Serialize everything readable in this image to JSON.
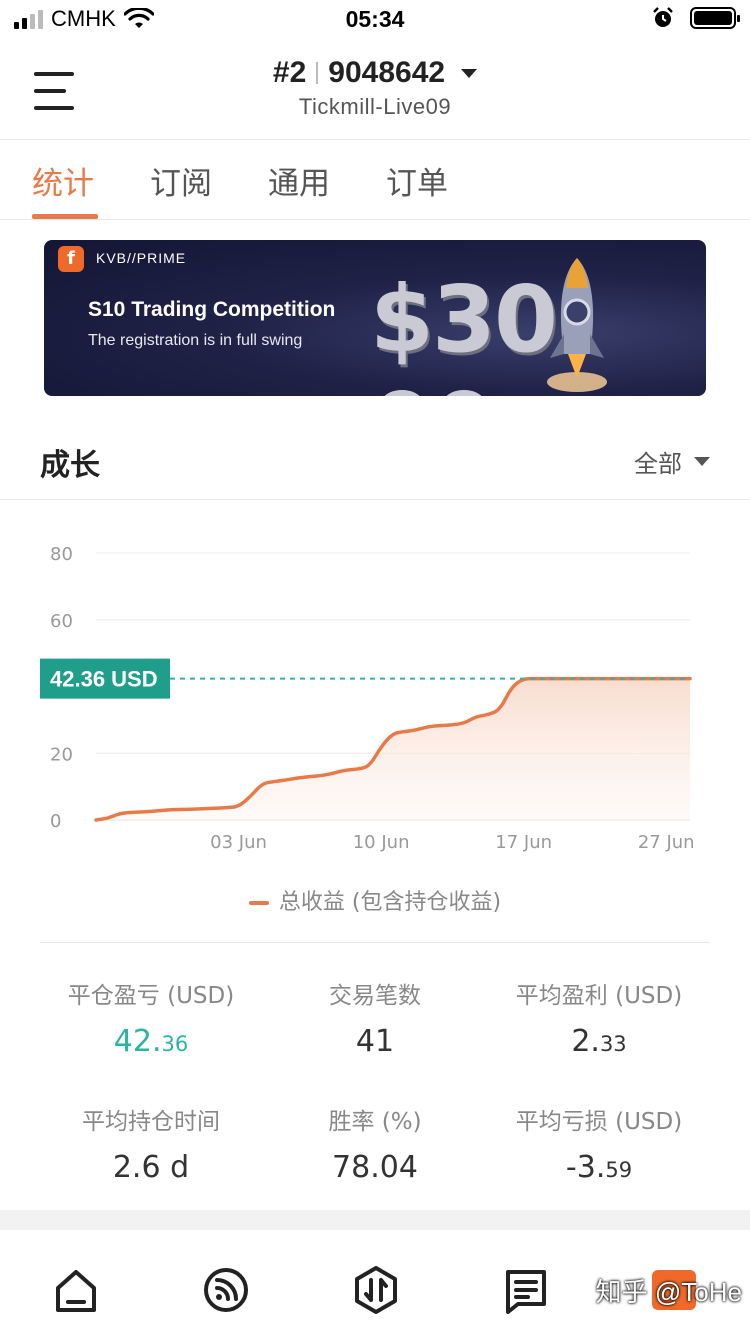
{
  "status": {
    "carrier": "CMHK",
    "time": "05:34"
  },
  "header": {
    "account_num": "#2",
    "account_id": "9048642",
    "server": "Tickmill-Live09"
  },
  "tabs": [
    {
      "label": "统计"
    },
    {
      "label": "订阅"
    },
    {
      "label": "通用"
    },
    {
      "label": "订单"
    }
  ],
  "banner": {
    "brand": "KVB//PRIME",
    "title": "S10 Trading Competition",
    "subtitle": "The registration is in full swing",
    "amount": "$30 00"
  },
  "growth": {
    "title": "成长",
    "filter": "全部"
  },
  "chart_data": {
    "type": "area",
    "y_ticks": [
      "80",
      "60",
      "20",
      "0"
    ],
    "x_ticks": [
      "03 Jun",
      "10 Jun",
      "17 Jun",
      "27 Jun"
    ],
    "current_label": "42.36 USD",
    "ylim": [
      0,
      80
    ],
    "series": [
      {
        "name": "总收益 (包含持仓收益)",
        "x": [
          0,
          1,
          2,
          3,
          4,
          5,
          6,
          7,
          8,
          9,
          10,
          11,
          12,
          13,
          14,
          15,
          16,
          17,
          18,
          19,
          20,
          21,
          22,
          23,
          24,
          25,
          26,
          27,
          28,
          29,
          30,
          31,
          32,
          33,
          34,
          35,
          36,
          37,
          38,
          39,
          40,
          41,
          42,
          43,
          44,
          45,
          46,
          47,
          48,
          49,
          50
        ],
        "values": [
          0,
          0.5,
          2,
          2.3,
          2.4,
          2.7,
          3,
          3.2,
          3.2,
          3.4,
          3.5,
          3.7,
          4,
          7,
          11,
          11.5,
          12,
          12.6,
          13,
          13.3,
          14,
          15,
          15.2,
          16,
          22,
          26,
          26.5,
          27,
          28,
          28.3,
          28.5,
          29,
          31,
          31.5,
          33,
          40,
          42.36,
          42.36,
          42.36,
          42.36,
          42.36,
          42.36,
          42.36,
          42.36,
          42.36,
          42.36,
          42.36,
          42.36,
          42.36,
          42.36,
          42.36
        ]
      }
    ]
  },
  "legend": {
    "label": "总收益 (包含持仓收益)"
  },
  "stats": [
    {
      "label": "平仓盈亏 (USD)",
      "int": "42.",
      "dec": "36",
      "green": true
    },
    {
      "label": "交易笔数",
      "int": "41",
      "dec": ""
    },
    {
      "label": "平均盈利 (USD)",
      "int": "2.",
      "dec": "33"
    },
    {
      "label": "平均持仓时间",
      "int": "2.6 d",
      "dec": ""
    },
    {
      "label": "胜率 (%)",
      "int": "78.04",
      "dec": ""
    },
    {
      "label": "平均亏损 (USD)",
      "int": "-3.",
      "dec": "59"
    }
  ],
  "watermark": "知乎 @ToHe",
  "colors": {
    "accent": "#e87a48",
    "green": "#2bb3a5"
  }
}
